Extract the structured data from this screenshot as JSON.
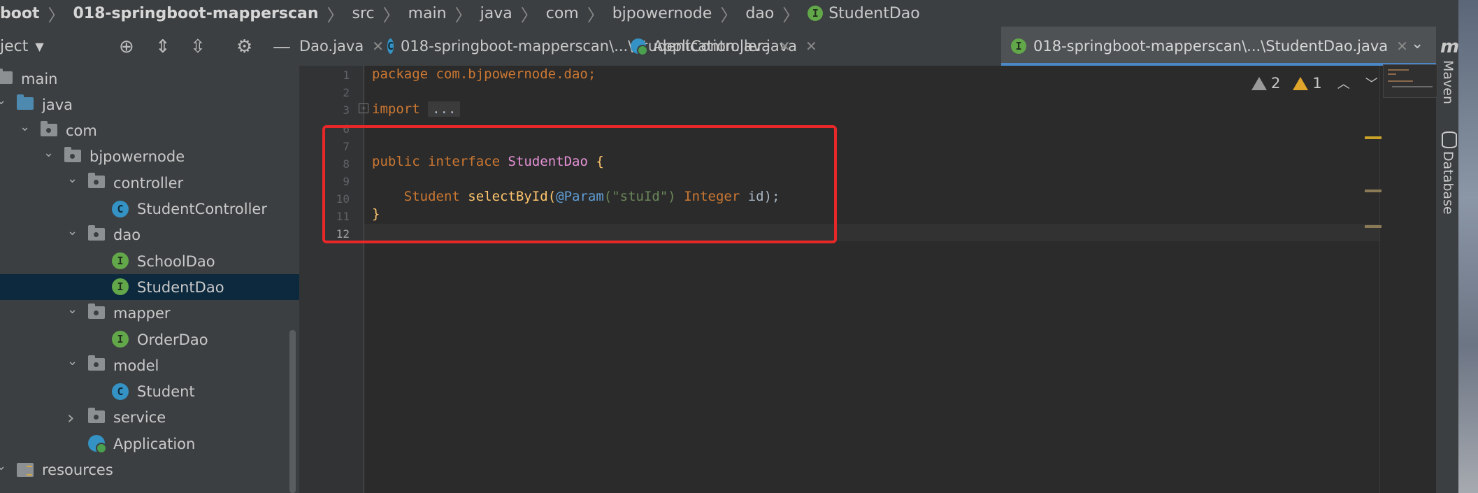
{
  "breadcrumb": [
    {
      "label": "boot",
      "bold": true
    },
    {
      "label": "018-springboot-mapperscan",
      "bold": true
    },
    {
      "label": "src"
    },
    {
      "label": "main"
    },
    {
      "label": "java"
    },
    {
      "label": "com"
    },
    {
      "label": "bjpowernode"
    },
    {
      "label": "dao"
    },
    {
      "label": "StudentDao",
      "icon": "interface-icon",
      "badge": "I"
    }
  ],
  "project_panel": {
    "title": "ject",
    "tools": [
      "locate-icon",
      "expand-all-icon",
      "collapse-all-icon",
      "gear-icon",
      "hide-icon"
    ]
  },
  "tree": [
    {
      "label": "main",
      "kind": "folder"
    },
    {
      "label": "java",
      "kind": "folder-blue",
      "expanded": true
    },
    {
      "label": "com",
      "kind": "package",
      "expanded": true
    },
    {
      "label": "bjpowernode",
      "kind": "package",
      "expanded": true
    },
    {
      "label": "controller",
      "kind": "package",
      "expanded": true
    },
    {
      "label": "StudentController",
      "kind": "class",
      "badge": "C"
    },
    {
      "label": "dao",
      "kind": "package",
      "expanded": true
    },
    {
      "label": "SchoolDao",
      "kind": "interface",
      "badge": "I"
    },
    {
      "label": "StudentDao",
      "kind": "interface",
      "badge": "I",
      "selected": true
    },
    {
      "label": "mapper",
      "kind": "package",
      "expanded": true
    },
    {
      "label": "OrderDao",
      "kind": "interface",
      "badge": "I"
    },
    {
      "label": "model",
      "kind": "package",
      "expanded": true
    },
    {
      "label": "Student",
      "kind": "class",
      "badge": "C"
    },
    {
      "label": "service",
      "kind": "package",
      "expanded": false
    },
    {
      "label": "Application",
      "kind": "app"
    },
    {
      "label": "resources",
      "kind": "resources",
      "expanded": true
    }
  ],
  "tabs": [
    {
      "label": "Dao.java",
      "close": "✕"
    },
    {
      "label": "018-springboot-mapperscan\\...\\StudentController.java",
      "badge": "C",
      "close": "✕"
    },
    {
      "label": "Application.java",
      "close": "✕"
    },
    {
      "label": "018-springboot-mapperscan\\...\\StudentDao.java",
      "badge": "I",
      "close": "✕",
      "active": true
    }
  ],
  "right_tools": {
    "maven": "Maven",
    "database": "Database",
    "maven_icon": "m"
  },
  "line_numbers": [
    "1",
    "2",
    "3",
    "6",
    "7",
    "8",
    "9",
    "10",
    "11",
    "12"
  ],
  "code": {
    "line1": {
      "kw": "package",
      "rest": " com.bjpowernode.dao;"
    },
    "line3": {
      "kw": "import",
      "ellipsis": "..."
    },
    "line8": {
      "kw1": "public",
      "kw2": "interface",
      "name": "StudentDao",
      "brace": "{"
    },
    "line10": {
      "type": "Student",
      "method": "selectById",
      "paren": "(",
      "ann": "@Param",
      "str": "(\"stuId\")",
      "kw": "Integer",
      "rest": " id);"
    },
    "line11": {
      "brace": "}"
    }
  },
  "inspections": {
    "warnings": "2",
    "weak_warnings": "1"
  },
  "colors": {
    "highlight_box": "#e82828",
    "active_tab_underline": "#4a88c7",
    "selection": "#0d293e"
  }
}
